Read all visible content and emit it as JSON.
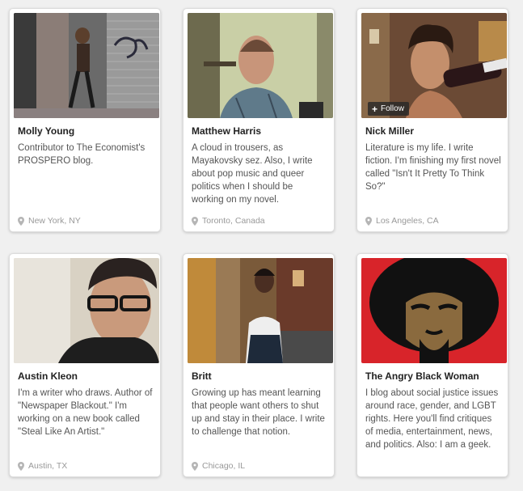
{
  "profiles": [
    {
      "name": "Molly Young",
      "bio": "Contributor to The Economist's PROSPERO blog.",
      "location": "New York, NY"
    },
    {
      "name": "Matthew Harris",
      "bio": "A cloud in trousers, as Mayakovsky sez. Also, I write about pop music and queer politics when I should be working on my novel.",
      "location": "Toronto, Canada"
    },
    {
      "name": "Nick Miller",
      "bio": "Literature is my life. I write fiction. I'm finishing my first novel called \"Isn't It Pretty To Think So?\"",
      "location": "Los Angeles, CA",
      "follow_label": "Follow"
    },
    {
      "name": "Austin Kleon",
      "bio": "I'm a writer who draws. Author of \"Newspaper Blackout.\" I'm working on a new book called \"Steal Like An Artist.\"",
      "location": "Austin, TX"
    },
    {
      "name": "Britt",
      "bio": "Growing up has meant learning that people want others to shut up and stay in their place. I write to challenge that notion.",
      "location": "Chicago, IL"
    },
    {
      "name": "The Angry Black Woman",
      "bio": "I blog about social justice issues around race, gender, and LGBT rights. Here you'll find critiques of media, entertainment, news, and politics. Also: I am a geek.",
      "location": ""
    }
  ],
  "icons": {
    "location": "map-pin-icon",
    "follow": "plus-icon"
  }
}
